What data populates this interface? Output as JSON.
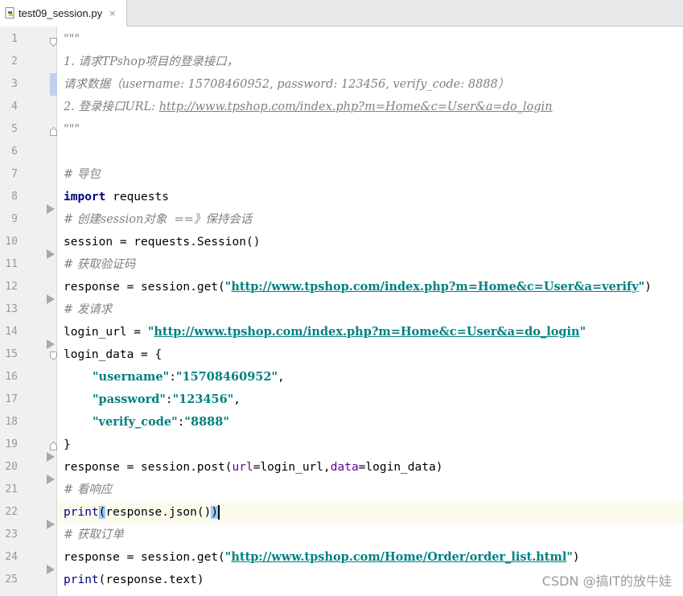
{
  "tab": {
    "title": "test09_session.py",
    "close_glyph": "×",
    "icon": "python-file-icon"
  },
  "line_numbers": [
    "1",
    "2",
    "3",
    "4",
    "5",
    "6",
    "7",
    "8",
    "9",
    "10",
    "11",
    "12",
    "13",
    "14",
    "15",
    "16",
    "17",
    "18",
    "19",
    "20",
    "21",
    "22",
    "23",
    "24",
    "25"
  ],
  "code": {
    "l1": "\"\"\"",
    "l2": "1. 请求TPshop项目的登录接口，",
    "l3": "请求数据（username: 15708460952, password: 123456, verify_code: 8888）",
    "l4_pre": "2. 登录接口URL: ",
    "l4_url": "http://www.tpshop.com/index.php?m=Home&c=User&a=do_login",
    "l5": "\"\"\"",
    "l7": "# 导包",
    "l8_kw": "import",
    "l8_rest": " requests",
    "l9": "# 创建session对象  ==》保持会话",
    "l10": "session = requests.Session()",
    "l11": "# 获取验证码",
    "l12_pre": "response = session.get(",
    "l12_q1": "\"",
    "l12_url": "http://www.tpshop.com/index.php?m=Home&c=User&a=verify",
    "l12_q2": "\"",
    "l12_post": ")",
    "l13": "# 发请求",
    "l14_pre": "login_url = ",
    "l14_q1": "\"",
    "l14_url": "http://www.tpshop.com/index.php?m=Home&c=User&a=do_login",
    "l14_q2": "\"",
    "l15": "login_data = {",
    "l16_key": "\"username\"",
    "l16_colon": ":",
    "l16_val": "\"15708460952\"",
    "l16_comma": ",",
    "l17_key": "\"password\"",
    "l17_colon": ":",
    "l17_val": "\"123456\"",
    "l17_comma": ",",
    "l18_key": "\"verify_code\"",
    "l18_colon": ":",
    "l18_val": "\"8888\"",
    "l19": "}",
    "l20_pre": "response = session.post(",
    "l20_k1": "url",
    "l20_mid": "=login_url,",
    "l20_k2": "data",
    "l20_post": "=login_data)",
    "l21": "# 看响应",
    "l22_fn": "print",
    "l22_open": "(",
    "l22_mid": "response.json()",
    "l22_close": ")",
    "l23": "# 获取订单",
    "l24_pre": "response = session.get(",
    "l24_q1": "\"",
    "l24_url": "http://www.tpshop.com/Home/Order/order_list.html",
    "l24_q2": "\"",
    "l24_post": ")",
    "l25_fn": "print",
    "l25_rest": "(response.text)"
  },
  "watermark": "CSDN @搞IT的放牛娃",
  "colors": {
    "keyword": "#000080",
    "string": "#008080",
    "comment": "#808080",
    "kwarg": "#660099",
    "caret_line": "#fcfaed",
    "paren_highlight": "#99ccff"
  }
}
